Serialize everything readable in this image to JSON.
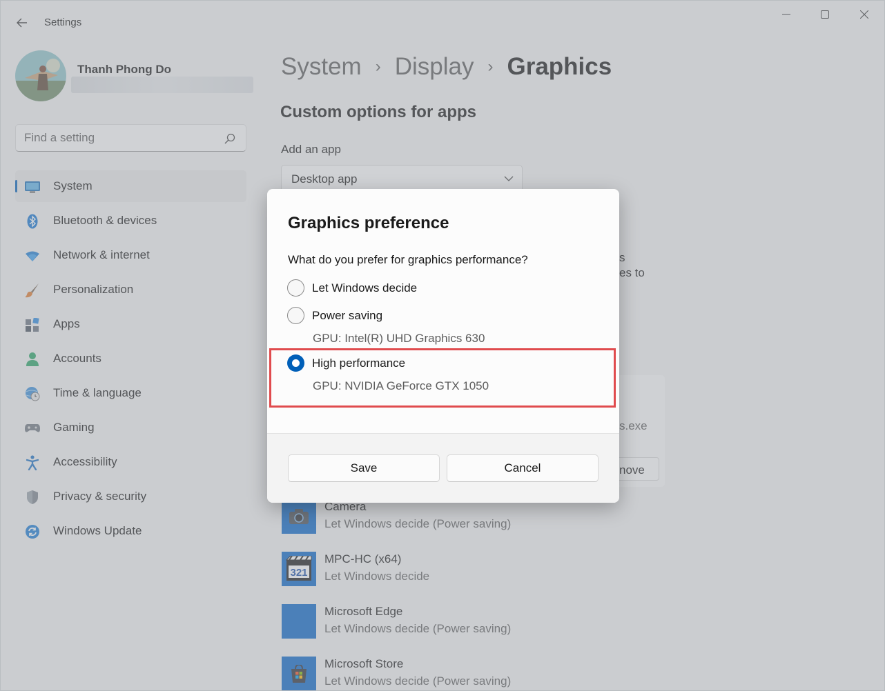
{
  "window": {
    "title": "Settings"
  },
  "user": {
    "name": "Thanh Phong Do"
  },
  "search": {
    "placeholder": "Find a setting"
  },
  "sidebar": {
    "items": [
      {
        "label": "System",
        "icon": "monitor-icon",
        "active": true
      },
      {
        "label": "Bluetooth & devices",
        "icon": "bluetooth-icon"
      },
      {
        "label": "Network & internet",
        "icon": "wifi-icon"
      },
      {
        "label": "Personalization",
        "icon": "brush-icon"
      },
      {
        "label": "Apps",
        "icon": "apps-icon"
      },
      {
        "label": "Accounts",
        "icon": "person-icon"
      },
      {
        "label": "Time & language",
        "icon": "globe-clock-icon"
      },
      {
        "label": "Gaming",
        "icon": "gamepad-icon"
      },
      {
        "label": "Accessibility",
        "icon": "accessibility-icon"
      },
      {
        "label": "Privacy & security",
        "icon": "shield-icon"
      },
      {
        "label": "Windows Update",
        "icon": "update-icon"
      }
    ]
  },
  "breadcrumb": {
    "items": [
      "System",
      "Display",
      "Graphics"
    ]
  },
  "main": {
    "section_title": "Custom options for apps",
    "add_label": "Add an app",
    "dropdown_value": "Desktop app",
    "partial_text_1": "s",
    "partial_text_2": "es to",
    "partial_exe": "s.exe",
    "partial_remove": "nove",
    "apps": [
      {
        "name": "Camera",
        "pref": "Let Windows decide (Power saving)",
        "icon": "camera-icon"
      },
      {
        "name": "MPC-HC (x64)",
        "pref": "Let Windows decide",
        "icon": "mpc-hc-icon"
      },
      {
        "name": "Microsoft Edge",
        "pref": "Let Windows decide (Power saving)",
        "icon": "edge-icon"
      },
      {
        "name": "Microsoft Store",
        "pref": "Let Windows decide (Power saving)",
        "icon": "store-icon"
      }
    ]
  },
  "dialog": {
    "title": "Graphics preference",
    "question": "What do you prefer for graphics performance?",
    "options": [
      {
        "label": "Let Windows decide",
        "gpu": "",
        "selected": false
      },
      {
        "label": "Power saving",
        "gpu": "GPU: Intel(R) UHD Graphics 630",
        "selected": false
      },
      {
        "label": "High performance",
        "gpu": "GPU: NVIDIA GeForce GTX 1050",
        "selected": true
      }
    ],
    "save_label": "Save",
    "cancel_label": "Cancel"
  },
  "colors": {
    "accent": "#005fb8",
    "highlight": "#e04b4e",
    "app_tile": "#0a66c8"
  }
}
